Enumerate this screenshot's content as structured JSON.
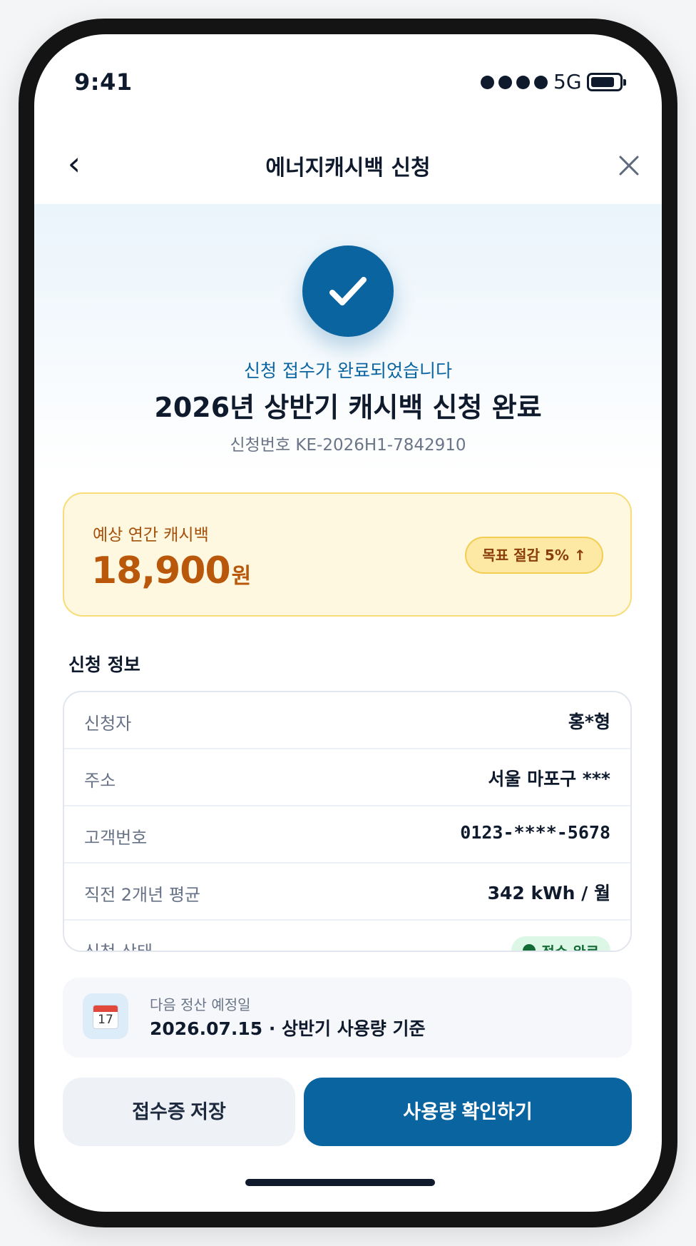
{
  "status_bar": {
    "time": "9:41",
    "network": "5G"
  },
  "nav": {
    "title": "에너지캐시백 신청",
    "back_icon": "‹"
  },
  "hero": {
    "subtitle": "신청 접수가 완료되었습니다",
    "title": "2026년 상반기 캐시백 신청 완료",
    "application_id": "신청번호 KE-2026H1-7842910"
  },
  "cashback": {
    "label": "예상 연간 캐시백",
    "amount": "18,900",
    "unit": "원",
    "badge": "목표 절감 5% ↑"
  },
  "info": {
    "section_title": "신청 정보",
    "rows": [
      {
        "label": "신청자",
        "value": "홍*형"
      },
      {
        "label": "주소",
        "value": "서울 마포구 ***"
      },
      {
        "label": "고객번호",
        "value": "0123-****-5678"
      },
      {
        "label": "직전 2개년 평균",
        "value": "342 kWh / 월"
      },
      {
        "label": "신청 상태",
        "value": "접수 완료"
      }
    ]
  },
  "next_settlement": {
    "icon_day": "17",
    "label": "다음 정산 예정일",
    "value": "2026.07.15 · 상반기 사용량 기준"
  },
  "buttons": {
    "secondary": "접수증 저장",
    "primary": "사용량 확인하기"
  },
  "colors": {
    "primary": "#0a64a0",
    "cashback_amount": "#b9570b",
    "status_green": "#126b35"
  }
}
